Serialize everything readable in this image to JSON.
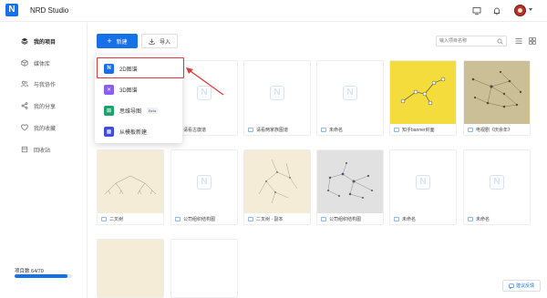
{
  "app": {
    "title": "NRD Studio",
    "logo_letter": "N"
  },
  "header": {
    "icons": [
      "monitor-icon",
      "bell-icon"
    ],
    "avatar": "user-avatar"
  },
  "sidebar": {
    "items": [
      {
        "label": "我的项目",
        "icon": "layers-icon",
        "active": true
      },
      {
        "label": "媒体库",
        "icon": "cube-icon",
        "active": false
      },
      {
        "label": "与我协作",
        "icon": "users-icon",
        "active": false
      },
      {
        "label": "我的分享",
        "icon": "share-icon",
        "active": false
      },
      {
        "label": "我的收藏",
        "icon": "heart-icon",
        "active": false
      },
      {
        "label": "回收站",
        "icon": "trash-icon",
        "active": false
      }
    ],
    "quota": {
      "label": "项目数 64/70",
      "used": 64,
      "total": 70
    }
  },
  "toolbar": {
    "new_label": "新建",
    "import_label": "导入",
    "search_placeholder": "输入项目名称"
  },
  "dropdown": {
    "items": [
      {
        "label": "2D图谱",
        "icon_text": "N",
        "color": "#1670e8",
        "badge": ""
      },
      {
        "label": "3D图谱",
        "icon_text": "✕",
        "color": "#8b5cf6",
        "badge": ""
      },
      {
        "label": "思维导图",
        "icon_text": "⊞",
        "color": "#22a06b",
        "badge": "Beta"
      },
      {
        "label": "从模板新建",
        "icon_text": "▦",
        "color": "#3b4fd8",
        "badge": ""
      }
    ]
  },
  "projects": [
    {
      "name": "",
      "thumb": "placeholder"
    },
    {
      "name": "",
      "thumb": "placeholder"
    },
    {
      "name": "请看古旗谱",
      "thumb": "placeholder"
    },
    {
      "name": "请看两家族图谱",
      "thumb": "placeholder"
    },
    {
      "name": "未命名",
      "thumb": "placeholder"
    },
    {
      "name": "知乎banner封面",
      "thumb": "yellow-graph"
    },
    {
      "name": "电视剧《庆余年》",
      "thumb": "network-graph"
    },
    {
      "name": "二叉树",
      "thumb": "tree-graph"
    },
    {
      "name": "公司组织结构图",
      "thumb": "placeholder"
    },
    {
      "name": "二叉树 - 副本",
      "thumb": "cream-graph"
    },
    {
      "name": "公司组织结构图",
      "thumb": "gray-graph"
    },
    {
      "name": "未命名",
      "thumb": "placeholder"
    },
    {
      "name": "未命名",
      "thumb": "placeholder"
    },
    {
      "name": "",
      "thumb": "cream-plain"
    }
  ],
  "feedback_label": "建议反馈",
  "colors": {
    "accent": "#1670e8",
    "highlight": "#e0393e"
  }
}
